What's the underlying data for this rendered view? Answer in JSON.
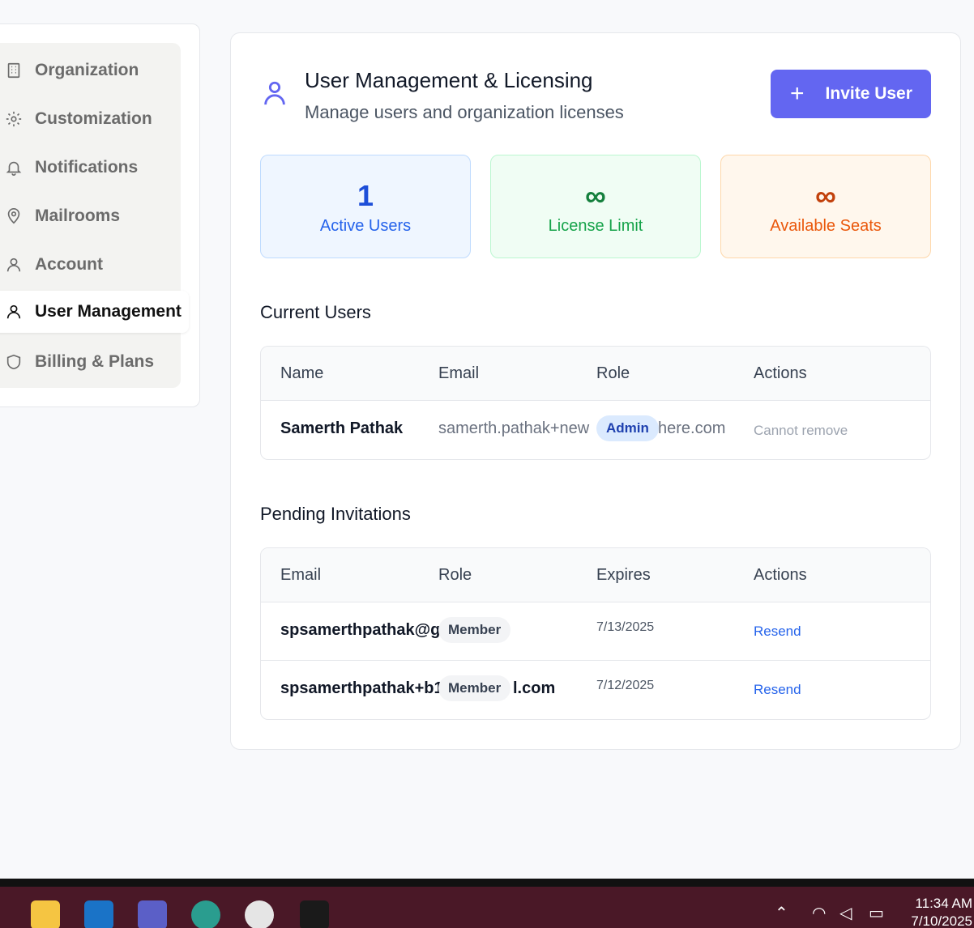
{
  "sidebar": {
    "items": [
      {
        "label": "Organization",
        "icon": "building-icon"
      },
      {
        "label": "Customization",
        "icon": "gear-icon"
      },
      {
        "label": "Notifications",
        "icon": "bell-icon"
      },
      {
        "label": "Mailrooms",
        "icon": "map-pin-icon"
      },
      {
        "label": "Account",
        "icon": "user-icon"
      },
      {
        "label": "User Management",
        "icon": "user-icon",
        "active": true
      },
      {
        "label": "Billing & Plans",
        "icon": "shield-icon"
      }
    ]
  },
  "header": {
    "title": "User Management & Licensing",
    "subtitle": "Manage users and organization licenses",
    "invite_label": "Invite User",
    "invite_icon": "plus-icon"
  },
  "stats": {
    "active_users": {
      "value": "1",
      "label": "Active Users"
    },
    "license_limit": {
      "value": "∞",
      "label": "License Limit"
    },
    "available_seats": {
      "value": "∞",
      "label": "Available Seats"
    }
  },
  "current_users": {
    "title": "Current Users",
    "headers": [
      "Name",
      "Email",
      "Role",
      "Actions"
    ],
    "rows": [
      {
        "name": "Samerth Pathak",
        "email_start": "samerth.pathak+new",
        "email_end": "here.com",
        "role": "Admin",
        "action": "Cannot remove"
      }
    ]
  },
  "pending": {
    "title": "Pending Invitations",
    "headers": [
      "Email",
      "Role",
      "Expires",
      "Actions"
    ],
    "rows": [
      {
        "email": "spsamerthpathak@g",
        "email_end": "",
        "role": "Member",
        "expires": "7/13/2025",
        "action": "Resend"
      },
      {
        "email": "spsamerthpathak+b1",
        "email_end": "l.com",
        "role": "Member",
        "expires": "7/12/2025",
        "action": "Resend"
      }
    ]
  },
  "taskbar": {
    "time": "11:34 AM",
    "date": "7/10/2025",
    "colors": {
      "background": "#4a1827",
      "accent": "#6366f1"
    }
  }
}
